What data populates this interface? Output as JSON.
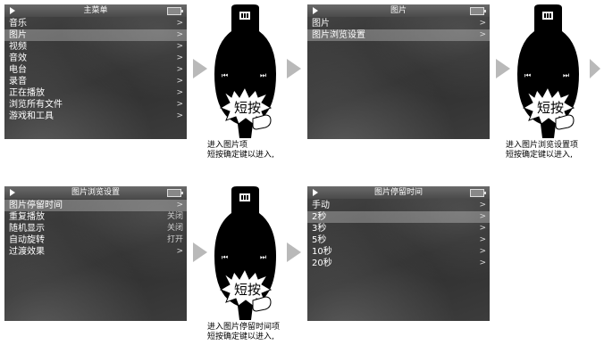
{
  "screens": [
    {
      "title": "主菜单",
      "items": [
        {
          "label": "音乐"
        },
        {
          "label": "图片"
        },
        {
          "label": "视频"
        },
        {
          "label": "音效"
        },
        {
          "label": "电台"
        },
        {
          "label": "录音"
        },
        {
          "label": "正在播放"
        },
        {
          "label": "浏览所有文件"
        },
        {
          "label": "游戏和工具"
        }
      ]
    },
    {
      "title": "图片",
      "items": [
        {
          "label": "图片"
        },
        {
          "label": "图片浏览设置"
        }
      ]
    },
    {
      "title": "图片浏览设置",
      "items": [
        {
          "label": "图片停留时间",
          "value": ""
        },
        {
          "label": "重复播放",
          "value": "关闭"
        },
        {
          "label": "随机显示",
          "value": "关闭"
        },
        {
          "label": "自动旋转",
          "value": "打开"
        },
        {
          "label": "过渡效果",
          "value": ""
        }
      ]
    },
    {
      "title": "图片停留时间",
      "items": [
        {
          "label": "手动"
        },
        {
          "label": "2秒"
        },
        {
          "label": "3秒"
        },
        {
          "label": "5秒"
        },
        {
          "label": "10秒"
        },
        {
          "label": "20秒"
        }
      ]
    }
  ],
  "device": {
    "press_label": "短按"
  },
  "captions": [
    {
      "line1": "进入图片项",
      "line2": "短按确定键以进入,"
    },
    {
      "line1": "进入图片浏览设置项",
      "line2": "短按确定键以进入,"
    },
    {
      "line1": "进入图片停留时间项",
      "line2": "短按确定键以进入,"
    }
  ],
  "icons": {
    "play": "play-icon",
    "battery": "battery-icon",
    "chevron": "chevron-right-icon",
    "prev": "previous-icon",
    "next": "next-icon",
    "hand": "pointing-hand-icon",
    "hold": "hold-switch-icon"
  }
}
